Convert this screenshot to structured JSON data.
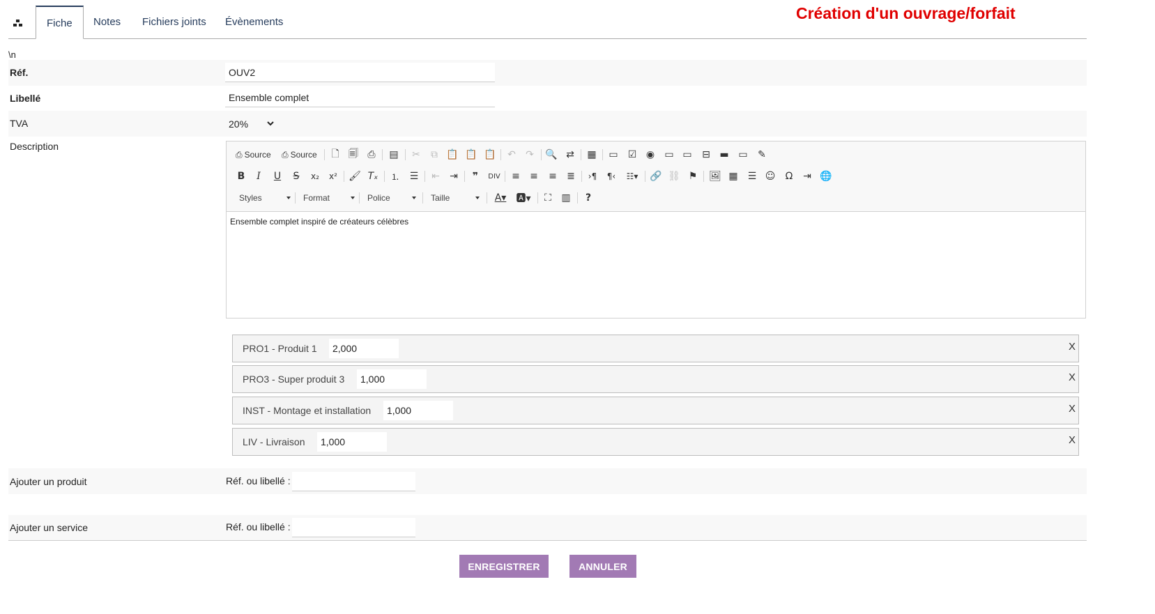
{
  "tabs": [
    {
      "label": "Fiche",
      "active": true
    },
    {
      "label": "Notes",
      "active": false
    },
    {
      "label": "Fichiers joints",
      "active": false
    },
    {
      "label": "Évènements",
      "active": false
    }
  ],
  "page_title": "Création d'un ouvrage/forfait",
  "stray_text": "\\n",
  "form": {
    "ref_label": "Réf.",
    "ref_value": "OUV2",
    "libelle_label": "Libellé",
    "libelle_value": "Ensemble complet",
    "tva_label": "TVA",
    "tva_value": "20%",
    "description_label": "Description"
  },
  "editor": {
    "source_label_1": "Source",
    "source_label_2": "Source",
    "combos": [
      "Styles",
      "Format",
      "Police",
      "Taille"
    ],
    "content": "Ensemble complet inspiré de créateurs célèbres"
  },
  "products": [
    {
      "name": "PRO1 - Produit 1",
      "qty": "2,000"
    },
    {
      "name": "PRO3 - Super produit 3",
      "qty": "1,000"
    },
    {
      "name": "INST - Montage et installation",
      "qty": "1,000"
    },
    {
      "name": "LIV - Livraison",
      "qty": "1,000"
    }
  ],
  "remove_label": "X",
  "add_product": {
    "label": "Ajouter un produit",
    "search_label": "Réf. ou libellé :",
    "value": ""
  },
  "add_service": {
    "label": "Ajouter un service",
    "search_label": "Réf. ou libellé :",
    "value": ""
  },
  "buttons": {
    "save": "ENREGISTRER",
    "cancel": "ANNULER"
  },
  "colors": {
    "title": "#e00000",
    "button": "#a27ab4",
    "tab_accent": "#263c5c"
  }
}
